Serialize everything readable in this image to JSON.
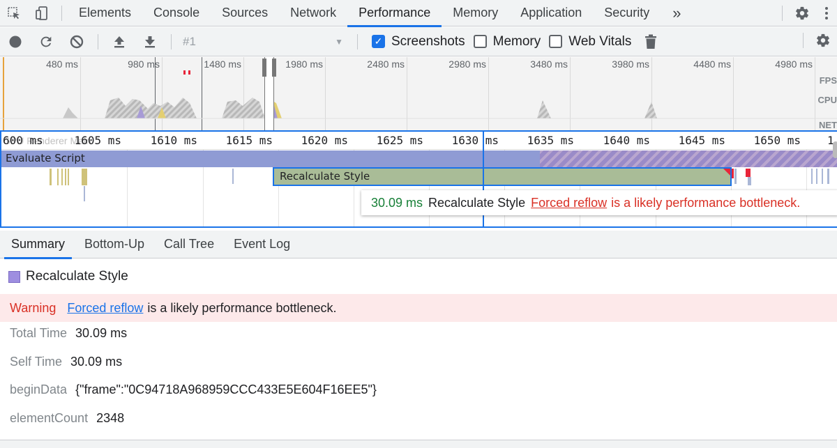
{
  "devtools": {
    "tabs": [
      {
        "label": "Elements"
      },
      {
        "label": "Console"
      },
      {
        "label": "Sources"
      },
      {
        "label": "Network"
      },
      {
        "label": "Performance"
      },
      {
        "label": "Memory"
      },
      {
        "label": "Application"
      },
      {
        "label": "Security"
      }
    ],
    "active_tab": "Performance",
    "overflow_label": "»"
  },
  "toolbar": {
    "profile": "#1",
    "checkboxes": [
      {
        "label": "Screenshots",
        "checked": true
      },
      {
        "label": "Memory",
        "checked": false
      },
      {
        "label": "Web Vitals",
        "checked": false
      }
    ]
  },
  "overview": {
    "ticks": [
      "480 ms",
      "980 ms",
      "1480 ms",
      "1980 ms",
      "2480 ms",
      "2980 ms",
      "3480 ms",
      "3980 ms",
      "4480 ms",
      "4980 ms"
    ],
    "track_labels": [
      "FPS",
      "CPU",
      "NET"
    ]
  },
  "flame": {
    "ruler_ticks": [
      "600 ms",
      "1605 ms",
      "1610 ms",
      "1615 ms",
      "1620 ms",
      "1625 ms",
      "1630 ms",
      "1635 ms",
      "1640 ms",
      "1645 ms",
      "1650 ms",
      "1"
    ],
    "ruler_overlay": "GPU Renderer Main",
    "evaluate_label": "Evaluate Script",
    "recalc_label": "Recalculate Style",
    "tooltip": {
      "duration": "30.09 ms",
      "name": "Recalculate Style",
      "link": "Forced reflow",
      "message": "is a likely performance bottleneck."
    }
  },
  "bottom_tabs": [
    {
      "label": "Summary"
    },
    {
      "label": "Bottom-Up"
    },
    {
      "label": "Call Tree"
    },
    {
      "label": "Event Log"
    }
  ],
  "summary": {
    "title": "Recalculate Style",
    "swatch_color": "#9e8ee0",
    "warning_label": "Warning",
    "warning_link": "Forced reflow",
    "warning_text": "is a likely performance bottleneck.",
    "rows": [
      {
        "key": "Total Time",
        "value": "30.09 ms"
      },
      {
        "key": "Self Time",
        "value": "30.09 ms"
      },
      {
        "key": "beginData",
        "value": "{\"frame\":\"0C94718A968959CCC433E5E604F16EE5\"}"
      },
      {
        "key": "elementCount",
        "value": "2348"
      }
    ]
  },
  "colors": {
    "accent": "#1a73e8",
    "warning": "#d93025",
    "evaluate_script": "#8f9bd4",
    "recalculate_style": "#a9bc97"
  }
}
